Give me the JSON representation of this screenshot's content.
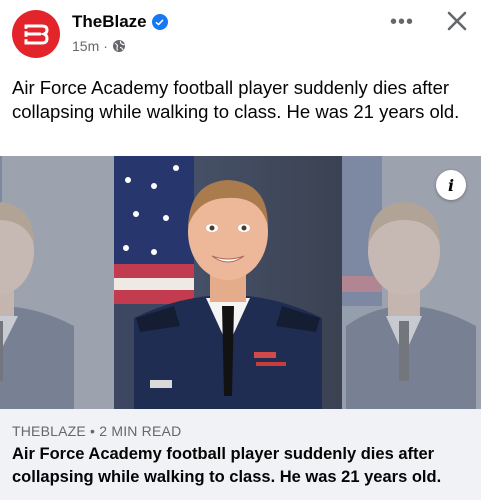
{
  "header": {
    "page_name": "TheBlaze",
    "timestamp": "15m",
    "separator": "·",
    "more_label": "•••"
  },
  "post": {
    "text": "Air Force Academy football player suddenly dies after collapsing while walking to class. He was 21 years old."
  },
  "link_preview": {
    "source": "THEBLAZE",
    "read_time": "2 MIN READ",
    "source_separator": "•",
    "headline": "Air Force Academy football player suddenly dies after collapsing while walking to class. He was 21 years old.",
    "info_label": "i"
  },
  "colors": {
    "brand": "#e3242b",
    "verified": "#1877f2",
    "uniform": "#1f2d52",
    "card_bg": "#f0f2f5"
  }
}
